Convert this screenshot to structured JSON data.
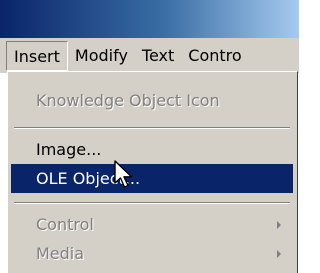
{
  "menubar": {
    "items": [
      {
        "label": "Insert"
      },
      {
        "label": "Modify"
      },
      {
        "label": "Text"
      },
      {
        "label": "Contro"
      }
    ]
  },
  "dropdown": {
    "items": [
      {
        "label": "Knowledge Object Icon",
        "enabled": false
      },
      {
        "label": "Image...",
        "enabled": true
      },
      {
        "label": "OLE Object...",
        "enabled": true,
        "selected": true
      },
      {
        "label": "Control",
        "enabled": false,
        "submenu": true
      },
      {
        "label": "Media",
        "enabled": false,
        "submenu": true
      }
    ]
  },
  "colors": {
    "selection": "#0a246a",
    "menu_background": "#d4d0c8",
    "disabled_text": "#808080"
  },
  "icons": {
    "submenu": "chevron-right-icon",
    "cursor": "mouse-pointer-icon"
  }
}
